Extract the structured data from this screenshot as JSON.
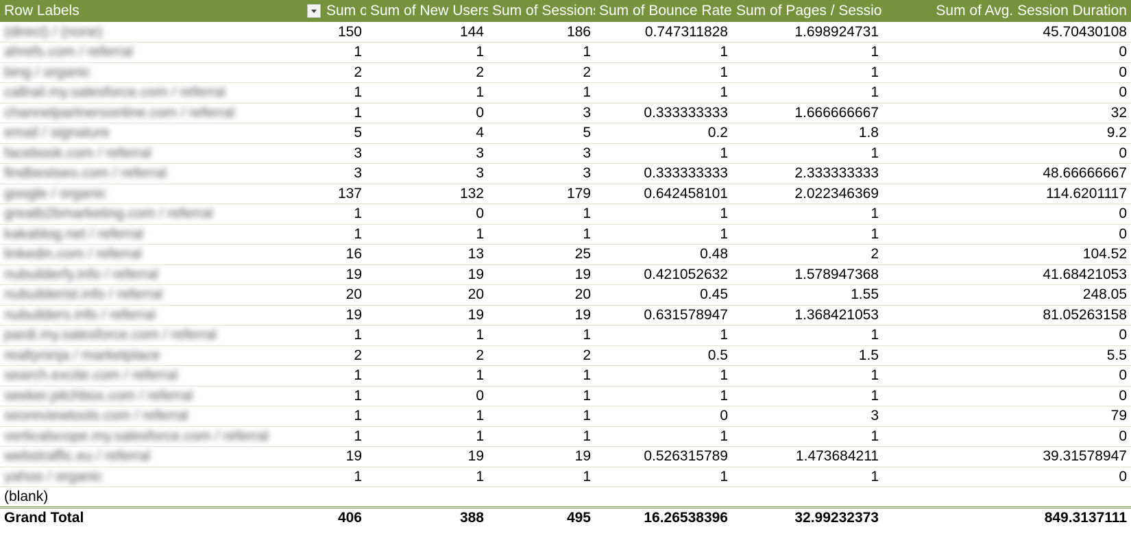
{
  "header": {
    "row_labels": "Row Labels",
    "columns": [
      "Sum of Users",
      "Sum of New Users",
      "Sum of Sessions",
      "Sum of Bounce Rate",
      "Sum of Pages / Session",
      "Sum of Avg. Session Duration"
    ]
  },
  "rows": [
    {
      "label": "(direct) / (none)",
      "values": [
        "150",
        "144",
        "186",
        "0.747311828",
        "1.698924731",
        "45.70430108"
      ]
    },
    {
      "label": "ahrefs.com / referral",
      "values": [
        "1",
        "1",
        "1",
        "1",
        "1",
        "0"
      ]
    },
    {
      "label": "bing / organic",
      "values": [
        "2",
        "2",
        "2",
        "1",
        "1",
        "0"
      ]
    },
    {
      "label": "callrail.my.salesforce.com / referral",
      "values": [
        "1",
        "1",
        "1",
        "1",
        "1",
        "0"
      ]
    },
    {
      "label": "channelpartnersonline.com / referral",
      "values": [
        "1",
        "0",
        "3",
        "0.333333333",
        "1.666666667",
        "32"
      ]
    },
    {
      "label": "email / signature",
      "values": [
        "5",
        "4",
        "5",
        "0.2",
        "1.8",
        "9.2"
      ]
    },
    {
      "label": "facebook.com / referral",
      "values": [
        "3",
        "3",
        "3",
        "1",
        "1",
        "0"
      ]
    },
    {
      "label": "findbestseo.com / referral",
      "values": [
        "3",
        "3",
        "3",
        "0.333333333",
        "2.333333333",
        "48.66666667"
      ]
    },
    {
      "label": "google / organic",
      "values": [
        "137",
        "132",
        "179",
        "0.642458101",
        "2.022346369",
        "114.6201117"
      ]
    },
    {
      "label": "greatb2bmarketing.com / referral",
      "values": [
        "1",
        "0",
        "1",
        "1",
        "1",
        "0"
      ]
    },
    {
      "label": "kakablog.net / referral",
      "values": [
        "1",
        "1",
        "1",
        "1",
        "1",
        "0"
      ]
    },
    {
      "label": "linkedin.com / referral",
      "values": [
        "16",
        "13",
        "25",
        "0.48",
        "2",
        "104.52"
      ]
    },
    {
      "label": "nubuilderfy.info / referral",
      "values": [
        "19",
        "19",
        "19",
        "0.421052632",
        "1.578947368",
        "41.68421053"
      ]
    },
    {
      "label": "nubuilderist.info / referral",
      "values": [
        "20",
        "20",
        "20",
        "0.45",
        "1.55",
        "248.05"
      ]
    },
    {
      "label": "nubuilders.info / referral",
      "values": [
        "19",
        "19",
        "19",
        "0.631578947",
        "1.368421053",
        "81.05263158"
      ]
    },
    {
      "label": "pardi.my.salesforce.com / referral",
      "values": [
        "1",
        "1",
        "1",
        "1",
        "1",
        "0"
      ]
    },
    {
      "label": "realtyninja / marketplace",
      "values": [
        "2",
        "2",
        "2",
        "0.5",
        "1.5",
        "5.5"
      ]
    },
    {
      "label": "search.excite.com / referral",
      "values": [
        "1",
        "1",
        "1",
        "1",
        "1",
        "0"
      ]
    },
    {
      "label": "seeker.pitchbox.com / referral",
      "values": [
        "1",
        "0",
        "1",
        "1",
        "1",
        "0"
      ]
    },
    {
      "label": "seoreviewtools.com / referral",
      "values": [
        "1",
        "1",
        "1",
        "0",
        "3",
        "79"
      ]
    },
    {
      "label": "verticalscope.my.salesforce.com / referral",
      "values": [
        "1",
        "1",
        "1",
        "1",
        "1",
        "0"
      ]
    },
    {
      "label": "webstraffic.eu / referral",
      "values": [
        "19",
        "19",
        "19",
        "0.526315789",
        "1.473684211",
        "39.31578947"
      ]
    },
    {
      "label": "yahoo / organic",
      "values": [
        "1",
        "1",
        "1",
        "1",
        "1",
        "0"
      ]
    }
  ],
  "blank_row": {
    "label": "(blank)"
  },
  "grand_total": {
    "label": "Grand Total",
    "values": [
      "406",
      "388",
      "495",
      "16.26538396",
      "32.99232373",
      "849.3137111"
    ]
  },
  "icons": {
    "filter": "dropdown-filter-icon"
  },
  "colors": {
    "header_bg": "#76923c",
    "header_text": "#ffffff",
    "row_border": "#dfe6cf"
  }
}
